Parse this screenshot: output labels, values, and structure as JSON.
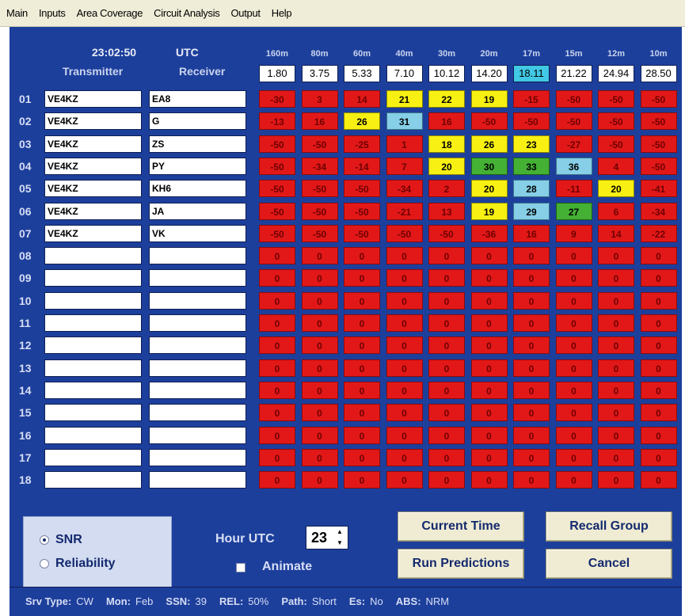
{
  "menu": [
    "Main",
    "Inputs",
    "Area Coverage",
    "Circuit Analysis",
    "Output",
    "Help"
  ],
  "clock": {
    "time": "23:02:50",
    "zone": "UTC"
  },
  "headers": {
    "transmitter": "Transmitter",
    "receiver": "Receiver"
  },
  "bands": [
    {
      "label": "160m",
      "freq": "1.80"
    },
    {
      "label": "80m",
      "freq": "3.75"
    },
    {
      "label": "60m",
      "freq": "5.33"
    },
    {
      "label": "40m",
      "freq": "7.10"
    },
    {
      "label": "30m",
      "freq": "10.12"
    },
    {
      "label": "20m",
      "freq": "14.20"
    },
    {
      "label": "17m",
      "freq": "18.11"
    },
    {
      "label": "15m",
      "freq": "21.22"
    },
    {
      "label": "12m",
      "freq": "24.94"
    },
    {
      "label": "10m",
      "freq": "28.50"
    }
  ],
  "selected_band_index": 6,
  "rows": [
    {
      "num": "01",
      "tx": "VE4KZ",
      "rx": "EA8",
      "values": [
        "-30",
        "3",
        "14",
        "21",
        "22",
        "19",
        "-15",
        "-50",
        "-50",
        "-50"
      ],
      "colors": [
        "red",
        "red",
        "red",
        "yellow",
        "yellow",
        "yellow",
        "red",
        "red",
        "red",
        "red"
      ]
    },
    {
      "num": "02",
      "tx": "VE4KZ",
      "rx": "G",
      "values": [
        "-13",
        "16",
        "26",
        "31",
        "16",
        "-50",
        "-50",
        "-50",
        "-50",
        "-50"
      ],
      "colors": [
        "red",
        "red",
        "yellow",
        "cyan",
        "red",
        "red",
        "red",
        "red",
        "red",
        "red"
      ]
    },
    {
      "num": "03",
      "tx": "VE4KZ",
      "rx": "ZS",
      "values": [
        "-50",
        "-50",
        "-25",
        "1",
        "18",
        "26",
        "23",
        "-27",
        "-50",
        "-50"
      ],
      "colors": [
        "red",
        "red",
        "red",
        "red",
        "yellow",
        "yellow",
        "yellow",
        "red",
        "red",
        "red"
      ]
    },
    {
      "num": "04",
      "tx": "VE4KZ",
      "rx": "PY",
      "values": [
        "-50",
        "-34",
        "-14",
        "7",
        "20",
        "30",
        "33",
        "36",
        "4",
        "-50"
      ],
      "colors": [
        "red",
        "red",
        "red",
        "red",
        "yellow",
        "green",
        "green",
        "cyan",
        "red",
        "red"
      ]
    },
    {
      "num": "05",
      "tx": "VE4KZ",
      "rx": "KH6",
      "values": [
        "-50",
        "-50",
        "-50",
        "-34",
        "2",
        "20",
        "28",
        "-11",
        "20",
        "-41"
      ],
      "colors": [
        "red",
        "red",
        "red",
        "red",
        "red",
        "yellow",
        "cyan",
        "red",
        "yellow",
        "red"
      ]
    },
    {
      "num": "06",
      "tx": "VE4KZ",
      "rx": "JA",
      "values": [
        "-50",
        "-50",
        "-50",
        "-21",
        "13",
        "19",
        "29",
        "27",
        "6",
        "-34"
      ],
      "colors": [
        "red",
        "red",
        "red",
        "red",
        "red",
        "yellow",
        "cyan",
        "green",
        "red",
        "red"
      ]
    },
    {
      "num": "07",
      "tx": "VE4KZ",
      "rx": "VK",
      "values": [
        "-50",
        "-50",
        "-50",
        "-50",
        "-50",
        "-36",
        "16",
        "9",
        "14",
        "-22"
      ],
      "colors": [
        "red",
        "red",
        "red",
        "red",
        "red",
        "red",
        "red",
        "red",
        "red",
        "red"
      ]
    },
    {
      "num": "08",
      "tx": "",
      "rx": "",
      "values": [
        "0",
        "0",
        "0",
        "0",
        "0",
        "0",
        "0",
        "0",
        "0",
        "0"
      ],
      "colors": [
        "red",
        "red",
        "red",
        "red",
        "red",
        "red",
        "red",
        "red",
        "red",
        "red"
      ]
    },
    {
      "num": "09",
      "tx": "",
      "rx": "",
      "values": [
        "0",
        "0",
        "0",
        "0",
        "0",
        "0",
        "0",
        "0",
        "0",
        "0"
      ],
      "colors": [
        "red",
        "red",
        "red",
        "red",
        "red",
        "red",
        "red",
        "red",
        "red",
        "red"
      ]
    },
    {
      "num": "10",
      "tx": "",
      "rx": "",
      "values": [
        "0",
        "0",
        "0",
        "0",
        "0",
        "0",
        "0",
        "0",
        "0",
        "0"
      ],
      "colors": [
        "red",
        "red",
        "red",
        "red",
        "red",
        "red",
        "red",
        "red",
        "red",
        "red"
      ]
    },
    {
      "num": "11",
      "tx": "",
      "rx": "",
      "values": [
        "0",
        "0",
        "0",
        "0",
        "0",
        "0",
        "0",
        "0",
        "0",
        "0"
      ],
      "colors": [
        "red",
        "red",
        "red",
        "red",
        "red",
        "red",
        "red",
        "red",
        "red",
        "red"
      ]
    },
    {
      "num": "12",
      "tx": "",
      "rx": "",
      "values": [
        "0",
        "0",
        "0",
        "0",
        "0",
        "0",
        "0",
        "0",
        "0",
        "0"
      ],
      "colors": [
        "red",
        "red",
        "red",
        "red",
        "red",
        "red",
        "red",
        "red",
        "red",
        "red"
      ]
    },
    {
      "num": "13",
      "tx": "",
      "rx": "",
      "values": [
        "0",
        "0",
        "0",
        "0",
        "0",
        "0",
        "0",
        "0",
        "0",
        "0"
      ],
      "colors": [
        "red",
        "red",
        "red",
        "red",
        "red",
        "red",
        "red",
        "red",
        "red",
        "red"
      ]
    },
    {
      "num": "14",
      "tx": "",
      "rx": "",
      "values": [
        "0",
        "0",
        "0",
        "0",
        "0",
        "0",
        "0",
        "0",
        "0",
        "0"
      ],
      "colors": [
        "red",
        "red",
        "red",
        "red",
        "red",
        "red",
        "red",
        "red",
        "red",
        "red"
      ]
    },
    {
      "num": "15",
      "tx": "",
      "rx": "",
      "values": [
        "0",
        "0",
        "0",
        "0",
        "0",
        "0",
        "0",
        "0",
        "0",
        "0"
      ],
      "colors": [
        "red",
        "red",
        "red",
        "red",
        "red",
        "red",
        "red",
        "red",
        "red",
        "red"
      ]
    },
    {
      "num": "16",
      "tx": "",
      "rx": "",
      "values": [
        "0",
        "0",
        "0",
        "0",
        "0",
        "0",
        "0",
        "0",
        "0",
        "0"
      ],
      "colors": [
        "red",
        "red",
        "red",
        "red",
        "red",
        "red",
        "red",
        "red",
        "red",
        "red"
      ]
    },
    {
      "num": "17",
      "tx": "",
      "rx": "",
      "values": [
        "0",
        "0",
        "0",
        "0",
        "0",
        "0",
        "0",
        "0",
        "0",
        "0"
      ],
      "colors": [
        "red",
        "red",
        "red",
        "red",
        "red",
        "red",
        "red",
        "red",
        "red",
        "red"
      ]
    },
    {
      "num": "18",
      "tx": "",
      "rx": "",
      "values": [
        "0",
        "0",
        "0",
        "0",
        "0",
        "0",
        "0",
        "0",
        "0",
        "0"
      ],
      "colors": [
        "red",
        "red",
        "red",
        "red",
        "red",
        "red",
        "red",
        "red",
        "red",
        "red"
      ]
    }
  ],
  "colors": {
    "red": "#e21818",
    "yellow": "#f8f012",
    "cyan": "#86cfe6",
    "green": "#44b034",
    "panel": "#1d3f9c"
  },
  "controls": {
    "snr_label": "SNR",
    "reliability_label": "Reliability",
    "mode_selected": "SNR",
    "hour_label": "Hour UTC",
    "hour_value": "23",
    "animate_label": "Animate",
    "animate_checked": false,
    "current_time": "Current Time",
    "recall_group": "Recall Group",
    "run_predictions": "Run Predictions",
    "cancel": "Cancel"
  },
  "status": [
    {
      "label": "Srv Type:",
      "value": "CW"
    },
    {
      "label": "Mon:",
      "value": "Feb"
    },
    {
      "label": "SSN:",
      "value": "39"
    },
    {
      "label": "REL:",
      "value": "50%"
    },
    {
      "label": "Path:",
      "value": "Short"
    },
    {
      "label": "Es:",
      "value": "No"
    },
    {
      "label": "ABS:",
      "value": "NRM"
    }
  ]
}
